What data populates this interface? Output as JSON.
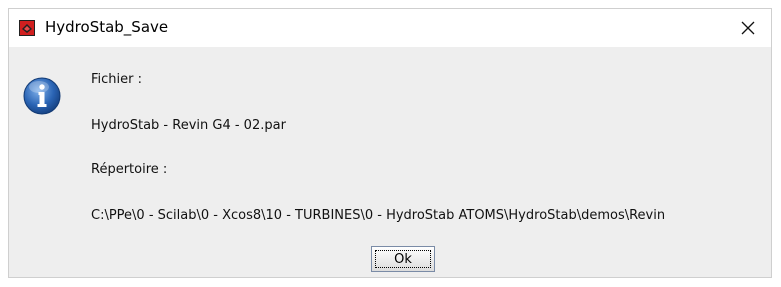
{
  "window": {
    "title": "HydroStab_Save",
    "close_glyph": "✕"
  },
  "dialog": {
    "file_label": "Fichier :",
    "file_value": "HydroStab - Revin G4 - 02.par",
    "directory_label": "Répertoire :",
    "directory_value": "C:\\PPe\\0 - Scilab\\0 - Xcos8\\10 - TURBINES\\0 - HydroStab ATOMS\\HydroStab\\demos\\Revin",
    "ok_label": "Ok",
    "icon": "info-icon"
  },
  "colors": {
    "info_blue": "#2a64b4",
    "dialog_bg": "#eeeeee"
  }
}
